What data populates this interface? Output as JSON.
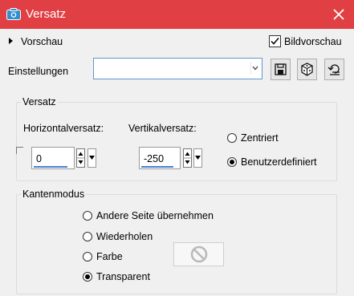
{
  "window": {
    "title": "Versatz",
    "icons": {
      "app": "camera-icon",
      "close": "close-icon"
    }
  },
  "preview": {
    "label": "Vorschau",
    "bildvorschau_label": "Bildvorschau",
    "bildvorschau_checked": true
  },
  "settings": {
    "label": "Einstellungen",
    "value": "",
    "buttons": {
      "save": "save-icon",
      "random": "dice-icon",
      "reset": "reset-icon"
    }
  },
  "offset_group": {
    "title": "Versatz",
    "horizontal_label": "Horizontalversatz:",
    "horizontal_value": "0",
    "vertical_label": "Vertikalversatz:",
    "vertical_value": "-250",
    "radios": [
      {
        "label": "Zentriert",
        "selected": false
      },
      {
        "label": "Benutzerdefiniert",
        "selected": true
      }
    ]
  },
  "edge_group": {
    "title": "Kantenmodus",
    "radios": [
      {
        "label": "Andere Seite übernehmen",
        "selected": false
      },
      {
        "label": "Wiederholen",
        "selected": false
      },
      {
        "label": "Farbe",
        "selected": false
      },
      {
        "label": "Transparent",
        "selected": true
      }
    ],
    "color_swatch_icon": "no-color-icon"
  },
  "colors": {
    "titlebar": "#e04044",
    "accent": "#4a7fd6",
    "background": "#f0f0f0"
  }
}
